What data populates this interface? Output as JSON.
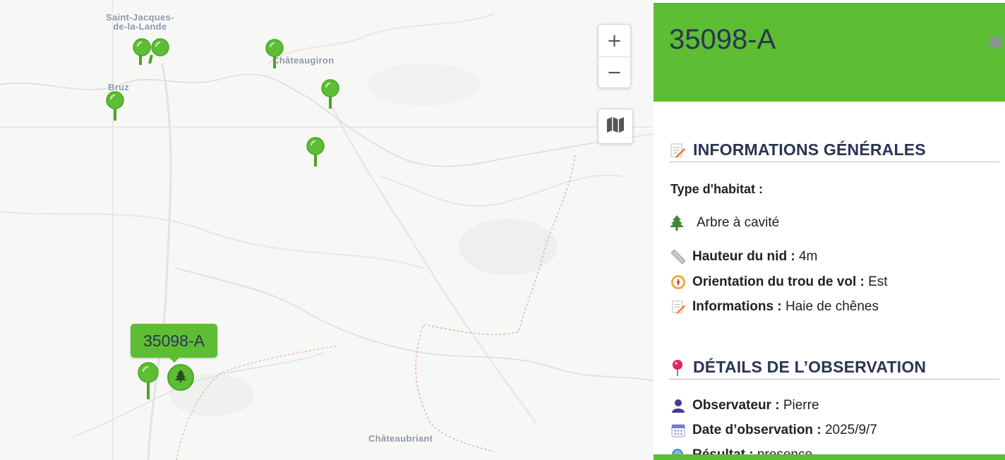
{
  "map": {
    "places": [
      {
        "name": "Saint-Jacques-\nde-la-Lande"
      },
      {
        "name": "Bruz"
      },
      {
        "name": "Châteaugiron"
      },
      {
        "name": "Châteaubriant"
      }
    ],
    "zoom_in": "+",
    "zoom_out": "−",
    "layers_icon": "map-icon",
    "tooltip": "35098-A",
    "marker_color": "#5dbd33"
  },
  "panel": {
    "title": "35098-A",
    "close": "✖",
    "header_color": "#5dbd33",
    "sections": {
      "general": {
        "title": "INFORMATIONS GÉNÉRALES",
        "habitat_label": "Type d'habitat :",
        "habitat_value": "Arbre à cavité",
        "height_label": "Hauteur du nid :",
        "height_value": "4m",
        "orientation_label": "Orientation du trou de vol :",
        "orientation_value": "Est",
        "info_label": "Informations :",
        "info_value": "Haie de chênes"
      },
      "observation": {
        "title": "DÉTAILS DE L’OBSERVATION",
        "observer_label": "Observateur :",
        "observer_value": "Pierre",
        "date_label": "Date d’observation :",
        "date_value": "2025/9/7",
        "result_label": "Résultat :",
        "result_value": "presence"
      }
    }
  }
}
